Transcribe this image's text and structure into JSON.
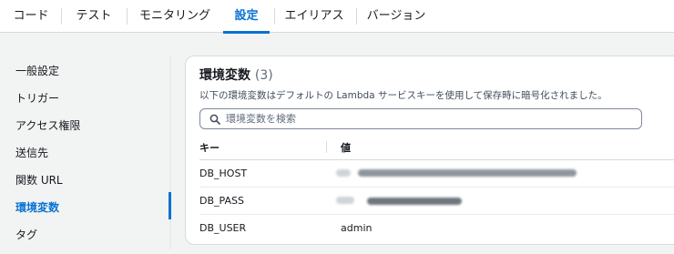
{
  "tabs": [
    {
      "label": "コード",
      "active": false
    },
    {
      "label": "テスト",
      "active": false
    },
    {
      "label": "モニタリング",
      "active": false
    },
    {
      "label": "設定",
      "active": true
    },
    {
      "label": "エイリアス",
      "active": false
    },
    {
      "label": "バージョン",
      "active": false
    }
  ],
  "sidenav": {
    "items": [
      {
        "label": "一般設定"
      },
      {
        "label": "トリガー"
      },
      {
        "label": "アクセス権限"
      },
      {
        "label": "送信先"
      },
      {
        "label": "関数 URL"
      },
      {
        "label": "環境変数",
        "active": true
      },
      {
        "label": "タグ"
      }
    ]
  },
  "panel": {
    "title": "環境変数",
    "count": "(3)",
    "description": "以下の環境変数はデフォルトの Lambda サービスキーを使用して保存時に暗号化されました。",
    "search": {
      "placeholder": "環境変数を検索",
      "value": "",
      "icon": "search-icon"
    },
    "columns": {
      "key": "キー",
      "value": "値"
    },
    "rows": [
      {
        "key": "DB_HOST",
        "value": "",
        "redacted": true
      },
      {
        "key": "DB_PASS",
        "value": "",
        "redacted": true
      },
      {
        "key": "DB_USER",
        "value": "admin",
        "redacted": false
      }
    ]
  },
  "colors": {
    "accent": "#0972d3",
    "text": "#16191f",
    "border": "#d5dbdb",
    "background": "#f2f3f3"
  }
}
